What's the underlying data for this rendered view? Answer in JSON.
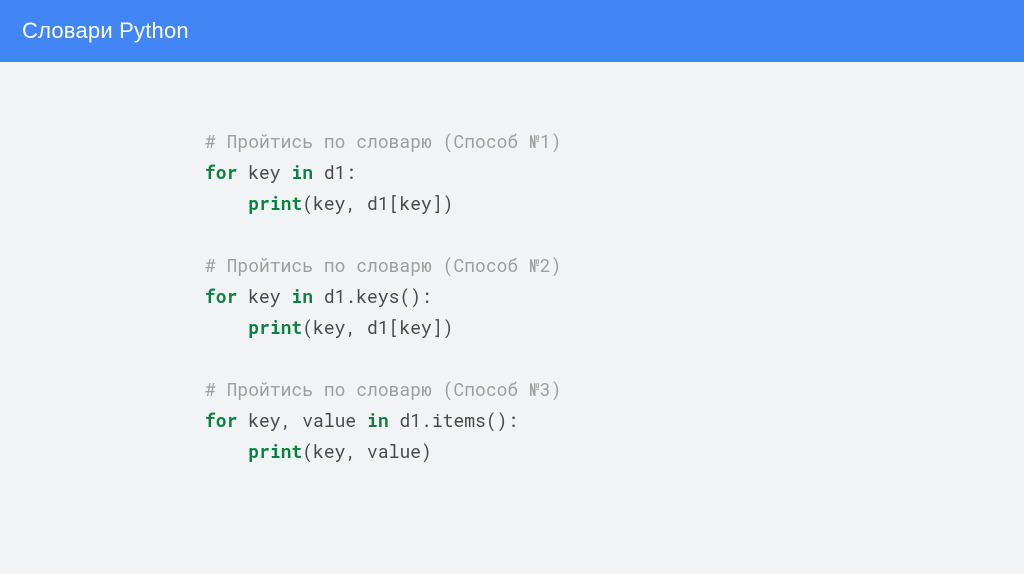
{
  "header": {
    "title": "Словари Python"
  },
  "code": {
    "c1": "# Пройтись по словарю (Способ №1)",
    "l2a": "for",
    "l2b": " key ",
    "l2c": "in",
    "l2d": " d1:",
    "l3a": "    ",
    "l3b": "print",
    "l3c": "(key, d1[key])",
    "c2": "# Пройтись по словарю (Способ №2)",
    "l6a": "for",
    "l6b": " key ",
    "l6c": "in",
    "l6d": " d1.keys():",
    "l7a": "    ",
    "l7b": "print",
    "l7c": "(key, d1[key])",
    "c3": "# Пройтись по словарю (Способ №3)",
    "l10a": "for",
    "l10b": " key, value ",
    "l10c": "in",
    "l10d": " d1.items():",
    "l11a": "    ",
    "l11b": "print",
    "l11c": "(key, value)"
  }
}
